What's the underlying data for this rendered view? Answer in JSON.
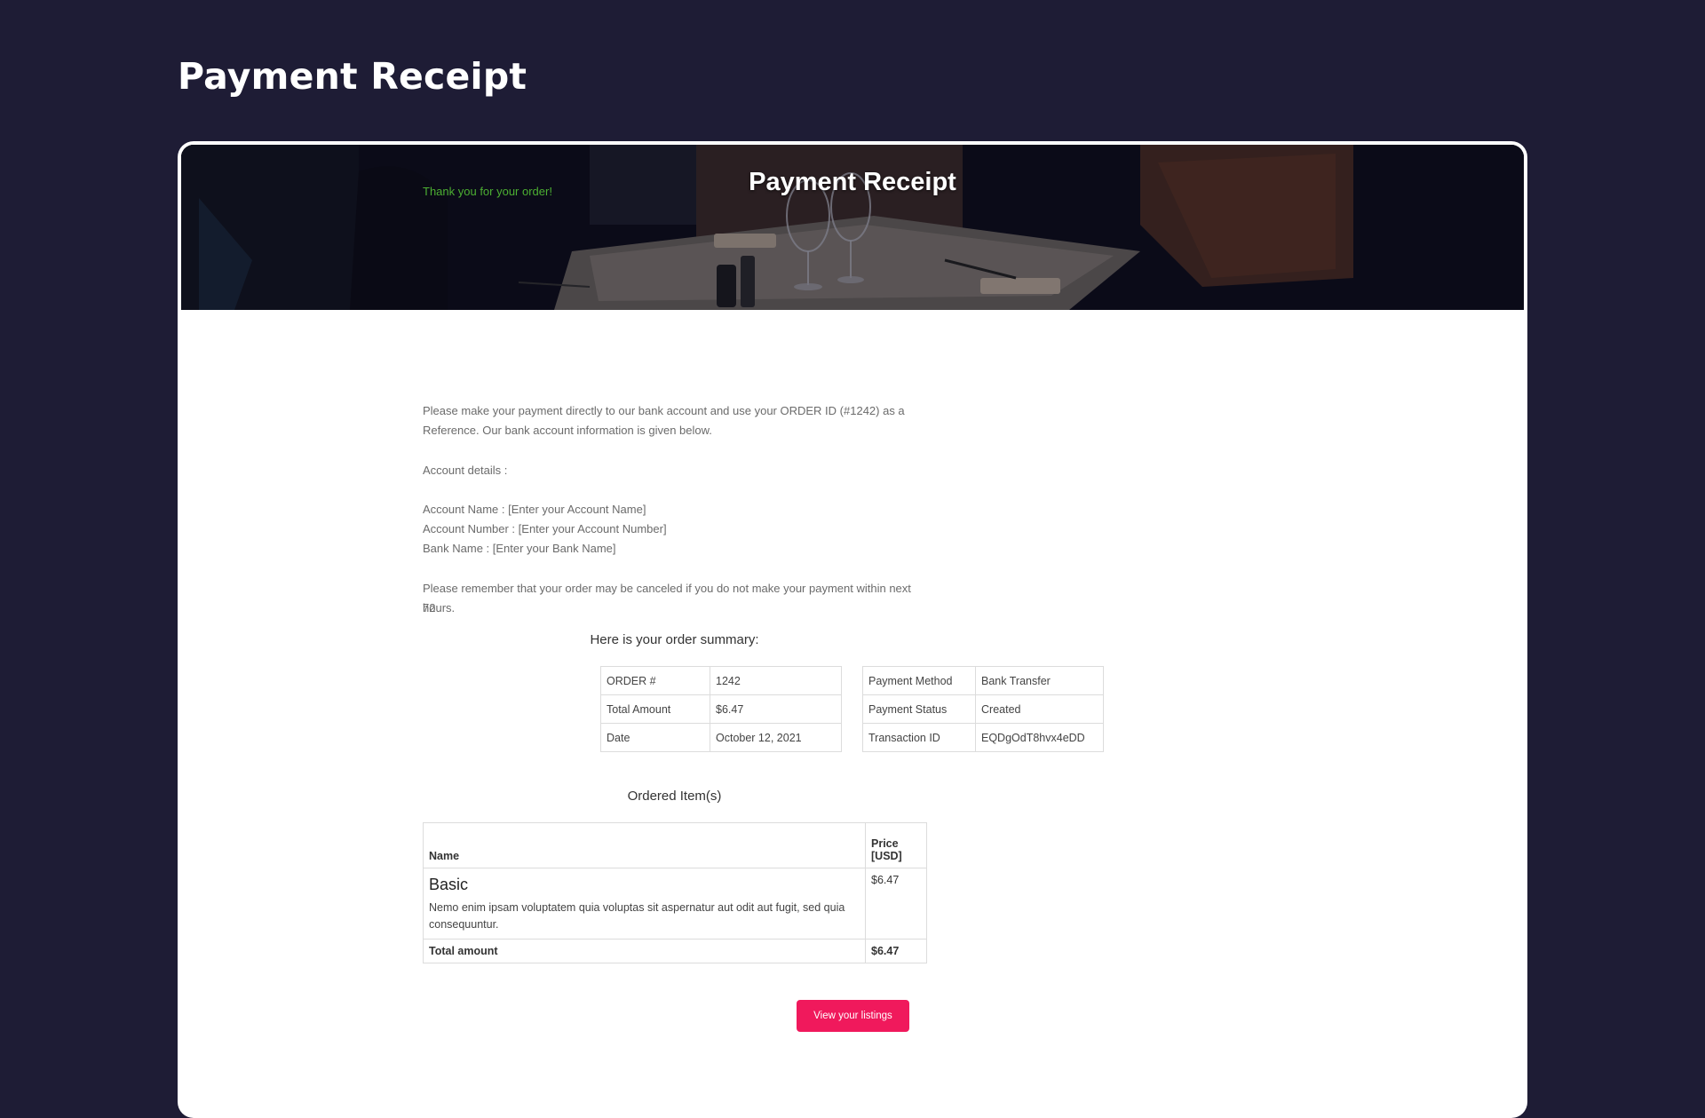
{
  "page": {
    "title": "Payment Receipt"
  },
  "hero": {
    "title": "Payment Receipt"
  },
  "message": {
    "thanks": "Thank you for your order!",
    "instructions_line1": "Please make your payment directly to our bank account and use your ORDER ID (#1242) as a",
    "instructions_line2": "Reference. Our bank account information is given below.",
    "account_details_label": "Account details :",
    "account_name": "Account Name : [Enter your Account Name]",
    "account_number": "Account Number : [Enter your Account Number]",
    "bank_name": "Bank Name : [Enter your Bank Name]",
    "reminder_line1": "Please remember that your order may be canceled if you do not make your payment within next 72",
    "reminder_line2": "hours."
  },
  "summary": {
    "heading": "Here is your order summary:",
    "left": [
      {
        "label": "ORDER #",
        "value": "1242"
      },
      {
        "label": "Total Amount",
        "value": "$6.47"
      },
      {
        "label": "Date",
        "value": "October 12, 2021"
      }
    ],
    "right": [
      {
        "label": "Payment Method",
        "value": "Bank Transfer"
      },
      {
        "label": "Payment Status",
        "value": "Created"
      },
      {
        "label": "Transaction ID",
        "value": "EQDgOdT8hvx4eDD"
      }
    ]
  },
  "items": {
    "heading": "Ordered Item(s)",
    "columns": {
      "name": "Name",
      "price_line1": "Price",
      "price_line2": "[USD]"
    },
    "rows": [
      {
        "name": "Basic",
        "description": "Nemo enim ipsam voluptatem quia voluptas sit aspernatur aut odit aut fugit, sed quia consequuntur.",
        "price": "$6.47"
      }
    ],
    "total_label": "Total amount",
    "total_value": "$6.47"
  },
  "cta": {
    "label": "View your listings"
  },
  "colors": {
    "background": "#1e1c35",
    "accent": "#f0195c",
    "success": "#4caf32"
  }
}
